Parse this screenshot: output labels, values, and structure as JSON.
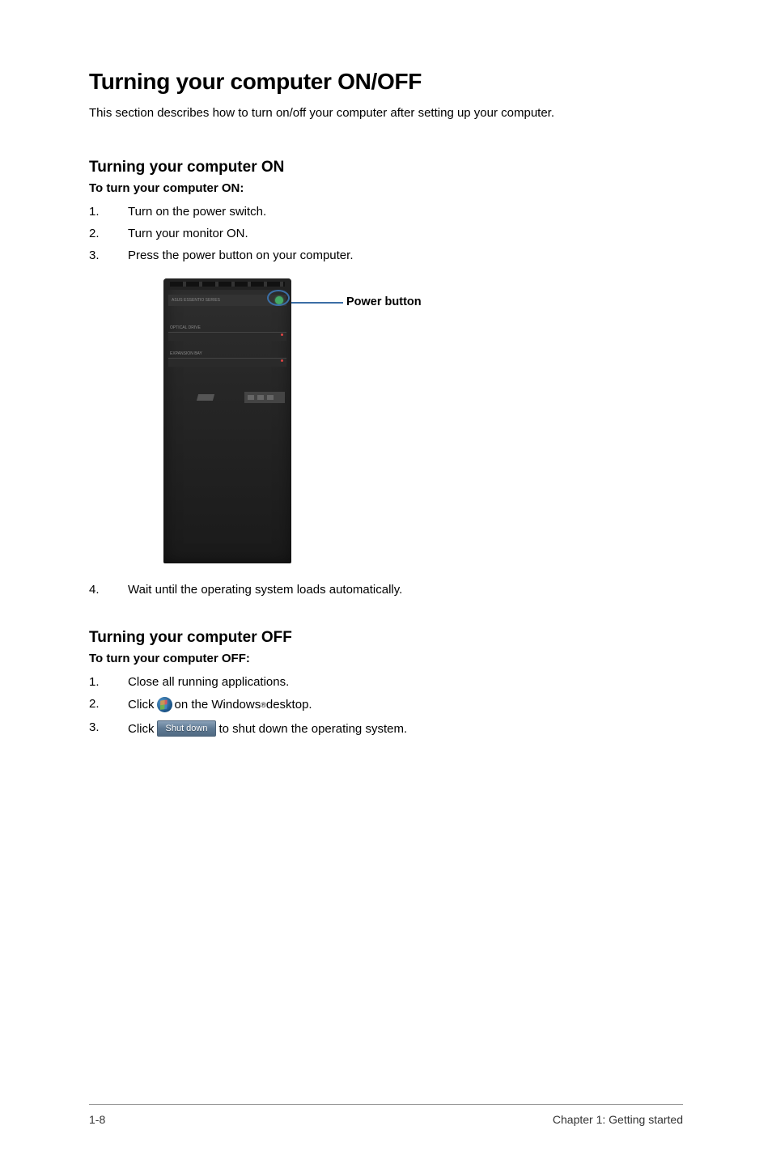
{
  "heading": "Turning your computer ON/OFF",
  "intro": "This section describes how to turn on/off your computer after setting up your computer.",
  "section_on": {
    "heading": "Turning your computer ON",
    "instruction": "To turn your computer ON:",
    "steps": [
      {
        "num": "1.",
        "text": "Turn on the power switch."
      },
      {
        "num": "2.",
        "text": "Turn your monitor ON."
      },
      {
        "num": "3.",
        "text": "Press the power button on your computer."
      }
    ],
    "figure": {
      "callout": "Power button",
      "brand_text": "ASUS ESSENTIO SERIES",
      "drive1": "OPTICAL DRIVE",
      "drive2": "EXPANSION BAY"
    },
    "step4": {
      "num": "4.",
      "text": "Wait until the operating system loads automatically."
    }
  },
  "section_off": {
    "heading": "Turning your computer OFF",
    "instruction": "To turn your computer OFF:",
    "steps": [
      {
        "num": "1.",
        "text": "Close all running applications."
      },
      {
        "num": "2.",
        "pre": "Click ",
        "post_pre": " on the Windows",
        "reg": "®",
        "post": " desktop."
      },
      {
        "num": "3.",
        "pre": "Click ",
        "btn": "Shut down",
        "post": " to shut down the operating system."
      }
    ]
  },
  "footer": {
    "left": "1-8",
    "right": "Chapter 1: Getting started"
  }
}
